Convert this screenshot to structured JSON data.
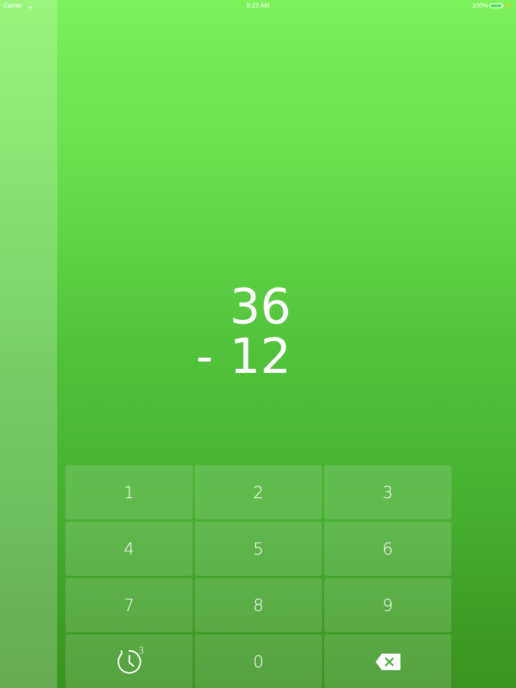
{
  "status_bar": {
    "carrier": "Carrier",
    "time": "8:23 AM",
    "battery": "100%"
  },
  "problem": {
    "top_operand": "36",
    "operator": "-",
    "bottom_operand": "12"
  },
  "keypad": {
    "keys": [
      "1",
      "2",
      "3",
      "4",
      "5",
      "6",
      "7",
      "8",
      "9"
    ],
    "zero": "0",
    "timer_badge": "3",
    "timer_icon": "timer-icon",
    "backspace_icon": "backspace-icon"
  },
  "colors": {
    "background_top": "#7df25a",
    "background_bottom": "#3a9320",
    "text": "#ffffff"
  }
}
